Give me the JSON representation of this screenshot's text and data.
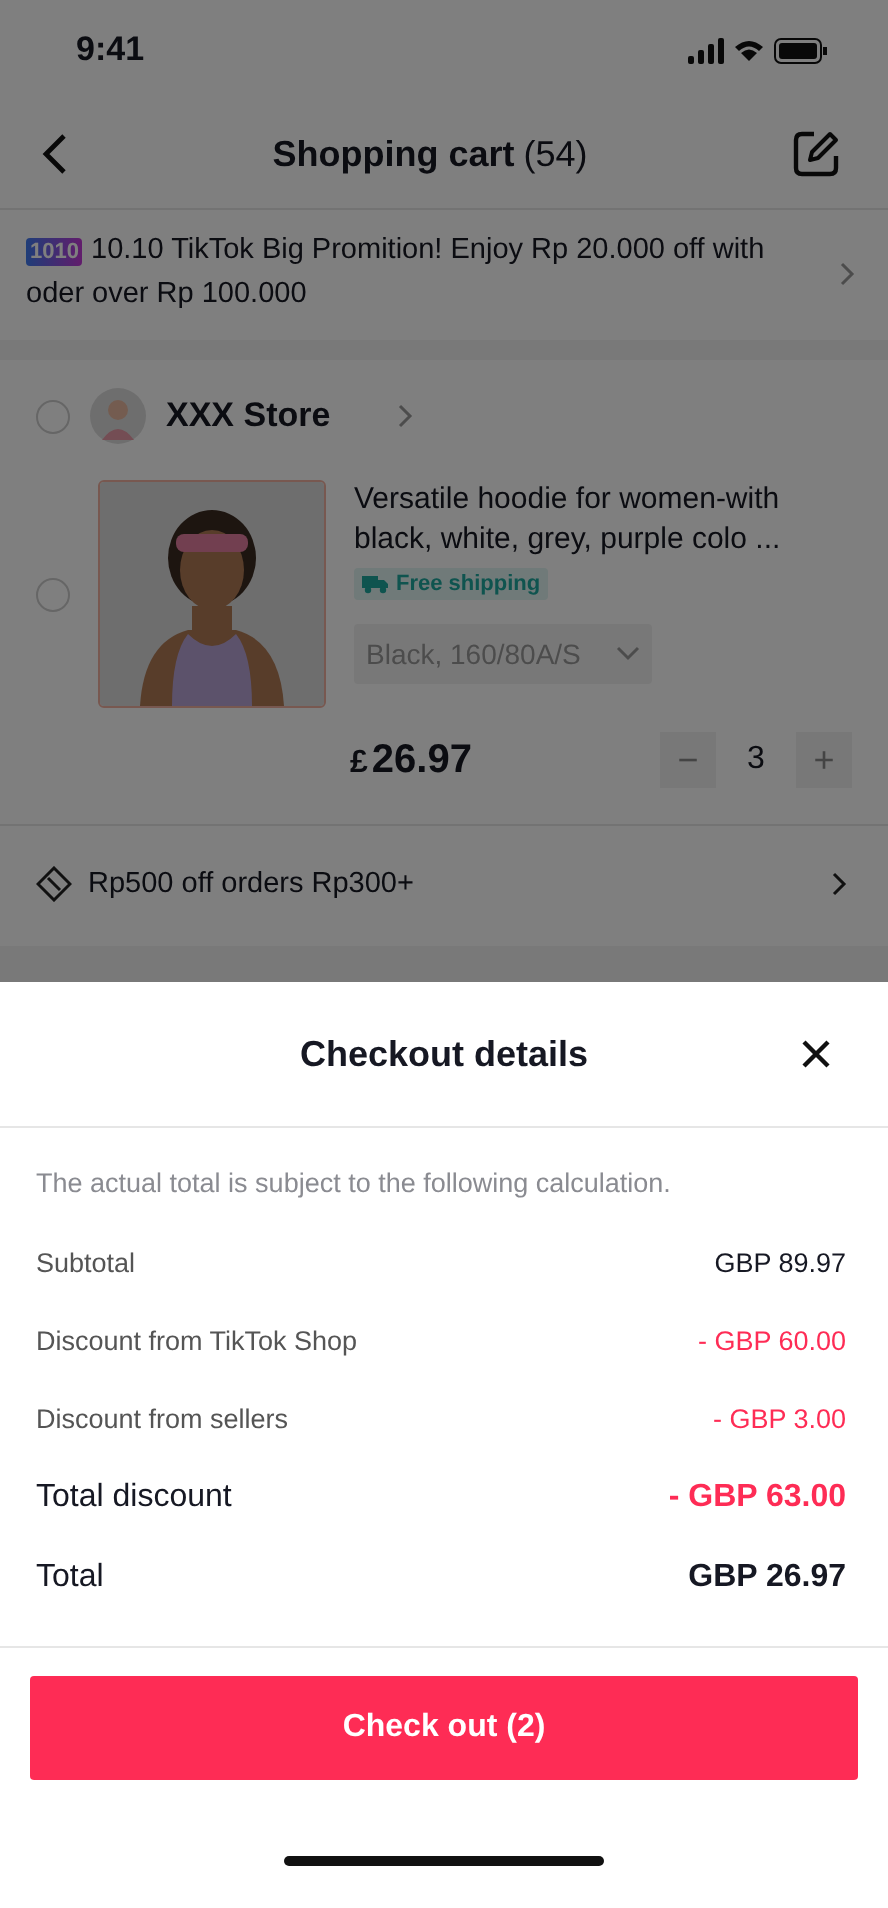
{
  "status_bar": {
    "time": "9:41"
  },
  "header": {
    "title": "Shopping cart",
    "count": "(54)"
  },
  "promo": {
    "badge": "1010",
    "text": "10.10 TikTok Big Promition! Enjoy Rp 20.000 off with oder over Rp 100.000"
  },
  "store": {
    "name": "XXX Store",
    "selected": false
  },
  "item": {
    "selected": false,
    "title": "Versatile hoodie for women-with black, white, grey, purple colo ...",
    "tag": "Free shipping",
    "variant": "Black, 160/80A/S",
    "price_symbol": "£",
    "price": "26.97",
    "quantity": "3",
    "minus": "−",
    "plus": "+"
  },
  "voucher": {
    "text": "Rp500 off orders Rp300+"
  },
  "sheet": {
    "title": "Checkout details",
    "note": "The actual total is subject to the following calculation.",
    "rows": [
      {
        "kind": "normal",
        "label": "Subtotal",
        "value": "GBP 89.97"
      },
      {
        "kind": "discount",
        "label": "Discount from TikTok Shop",
        "value": "- GBP 60.00"
      },
      {
        "kind": "discount",
        "label": "Discount from sellers",
        "value": "- GBP 3.00"
      },
      {
        "kind": "total_discount",
        "label": "Total discount",
        "value": "- GBP 63.00"
      },
      {
        "kind": "total",
        "label": "Total",
        "value": "GBP 26.97"
      }
    ],
    "button": "Check out (2)"
  }
}
